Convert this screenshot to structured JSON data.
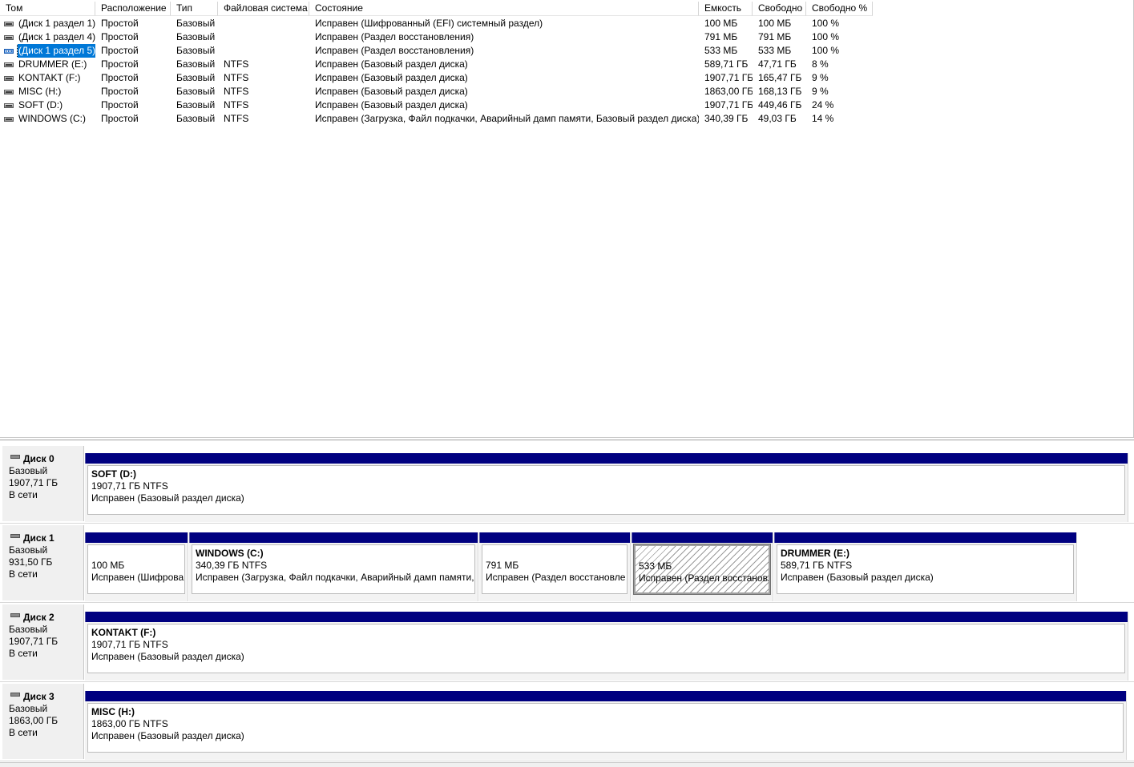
{
  "volume_list": {
    "columns": [
      "Том",
      "Расположение",
      "Тип",
      "Файловая система",
      "Состояние",
      "Емкость",
      "Свободно",
      "Свободно %"
    ],
    "rows": [
      {
        "name": "(Диск 1 раздел 1)",
        "layout": "Простой",
        "type": "Базовый",
        "fs": "",
        "status": "Исправен (Шифрованный (EFI) системный раздел)",
        "capacity": "100 МБ",
        "free": "100 МБ",
        "free_pct": "100 %",
        "selected": false
      },
      {
        "name": "(Диск 1 раздел 4)",
        "layout": "Простой",
        "type": "Базовый",
        "fs": "",
        "status": "Исправен (Раздел восстановления)",
        "capacity": "791 МБ",
        "free": "791 МБ",
        "free_pct": "100 %",
        "selected": false
      },
      {
        "name": "(Диск 1 раздел 5)",
        "layout": "Простой",
        "type": "Базовый",
        "fs": "",
        "status": "Исправен (Раздел восстановления)",
        "capacity": "533 МБ",
        "free": "533 МБ",
        "free_pct": "100 %",
        "selected": true
      },
      {
        "name": "DRUMMER (E:)",
        "layout": "Простой",
        "type": "Базовый",
        "fs": "NTFS",
        "status": "Исправен (Базовый раздел диска)",
        "capacity": "589,71 ГБ",
        "free": "47,71 ГБ",
        "free_pct": "8 %",
        "selected": false
      },
      {
        "name": "KONTAKT (F:)",
        "layout": "Простой",
        "type": "Базовый",
        "fs": "NTFS",
        "status": "Исправен (Базовый раздел диска)",
        "capacity": "1907,71 ГБ",
        "free": "165,47 ГБ",
        "free_pct": "9 %",
        "selected": false
      },
      {
        "name": "MISC (H:)",
        "layout": "Простой",
        "type": "Базовый",
        "fs": "NTFS",
        "status": "Исправен (Базовый раздел диска)",
        "capacity": "1863,00 ГБ",
        "free": "168,13 ГБ",
        "free_pct": "9 %",
        "selected": false
      },
      {
        "name": "SOFT (D:)",
        "layout": "Простой",
        "type": "Базовый",
        "fs": "NTFS",
        "status": "Исправен (Базовый раздел диска)",
        "capacity": "1907,71 ГБ",
        "free": "449,46 ГБ",
        "free_pct": "24 %",
        "selected": false
      },
      {
        "name": "WINDOWS (C:)",
        "layout": "Простой",
        "type": "Базовый",
        "fs": "NTFS",
        "status": "Исправен (Загрузка, Файл подкачки, Аварийный дамп памяти, Базовый раздел диска)",
        "capacity": "340,39 ГБ",
        "free": "49,03 ГБ",
        "free_pct": "14 %",
        "selected": false
      }
    ]
  },
  "disks": [
    {
      "title": "Диск 0",
      "type": "Базовый",
      "size": "1907,71 ГБ",
      "state": "В сети",
      "partitions": [
        {
          "name": "SOFT  (D:)",
          "size": "1907,71 ГБ NTFS",
          "status": "Исправен (Базовый раздел диска)",
          "selected": false
        }
      ]
    },
    {
      "title": "Диск 1",
      "type": "Базовый",
      "size": "931,50 ГБ",
      "state": "В сети",
      "partitions": [
        {
          "name": "",
          "size": "100 МБ",
          "status": "Исправен (Шифрова",
          "selected": false
        },
        {
          "name": "WINDOWS  (C:)",
          "size": "340,39 ГБ NTFS",
          "status": "Исправен (Загрузка, Файл подкачки, Аварийный дамп памяти,",
          "selected": false
        },
        {
          "name": "",
          "size": "791 МБ",
          "status": "Исправен (Раздел восстановле",
          "selected": false
        },
        {
          "name": "",
          "size": "533 МБ",
          "status": "Исправен (Раздел восстановл",
          "selected": true
        },
        {
          "name": "DRUMMER  (E:)",
          "size": "589,71 ГБ NTFS",
          "status": "Исправен (Базовый раздел диска)",
          "selected": false
        }
      ]
    },
    {
      "title": "Диск 2",
      "type": "Базовый",
      "size": "1907,71 ГБ",
      "state": "В сети",
      "partitions": [
        {
          "name": "KONTAKT  (F:)",
          "size": "1907,71 ГБ NTFS",
          "status": "Исправен (Базовый раздел диска)",
          "selected": false
        }
      ]
    },
    {
      "title": "Диск 3",
      "type": "Базовый",
      "size": "1863,00 ГБ",
      "state": "В сети",
      "partitions": [
        {
          "name": "MISC  (H:)",
          "size": "1863,00 ГБ NTFS",
          "status": "Исправен (Базовый раздел диска)",
          "selected": false
        }
      ]
    }
  ],
  "colors": {
    "partition_bar": "#000080",
    "selection": "#0078d7"
  }
}
